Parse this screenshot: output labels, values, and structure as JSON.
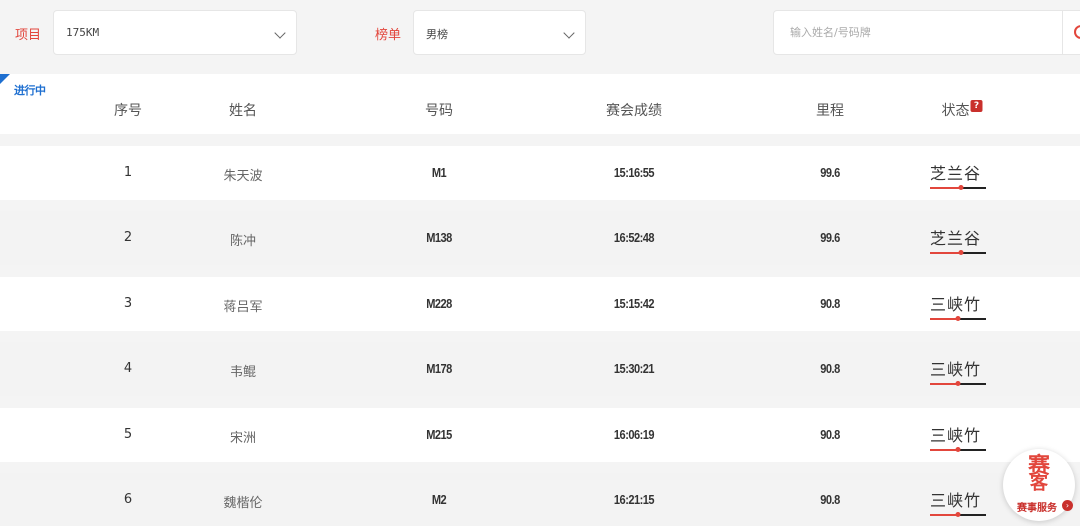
{
  "filters": {
    "event_label": "项目",
    "event_value": "175KM",
    "board_label": "榜单",
    "board_value": "男榜",
    "search_placeholder": "输入姓名/号码牌"
  },
  "table": {
    "live_badge": "进行中",
    "headers": {
      "rank": "序号",
      "name": "姓名",
      "bib": "号码",
      "result": "赛会成绩",
      "distance": "里程",
      "status": "状态"
    },
    "help_icon_text": "?",
    "rows": [
      {
        "rank": "1",
        "name": "朱天波",
        "bib": "M1",
        "result": "15:16:55",
        "distance": "99.6",
        "status": "芝兰谷",
        "progress": 0.55
      },
      {
        "rank": "2",
        "name": "陈冲",
        "bib": "M138",
        "result": "16:52:48",
        "distance": "99.6",
        "status": "芝兰谷",
        "progress": 0.55
      },
      {
        "rank": "3",
        "name": "蒋吕军",
        "bib": "M228",
        "result": "15:15:42",
        "distance": "90.8",
        "status": "三峡竹",
        "progress": 0.5
      },
      {
        "rank": "4",
        "name": "韦鲲",
        "bib": "M178",
        "result": "15:30:21",
        "distance": "90.8",
        "status": "三峡竹",
        "progress": 0.5
      },
      {
        "rank": "5",
        "name": "宋洲",
        "bib": "M215",
        "result": "16:06:19",
        "distance": "90.8",
        "status": "三峡竹",
        "progress": 0.5
      },
      {
        "rank": "6",
        "name": "魏楷伦",
        "bib": "M2",
        "result": "16:21:15",
        "distance": "90.8",
        "status": "三峡竹",
        "progress": 0.5
      }
    ]
  },
  "service_badge": {
    "logo_top": "赛",
    "logo_bottom": "客",
    "label": "赛事服务",
    "arrow": "›"
  },
  "colors": {
    "accent": "#e2463c",
    "live_blue": "#1e6fd0",
    "row_alt": "#f3f3f3"
  }
}
